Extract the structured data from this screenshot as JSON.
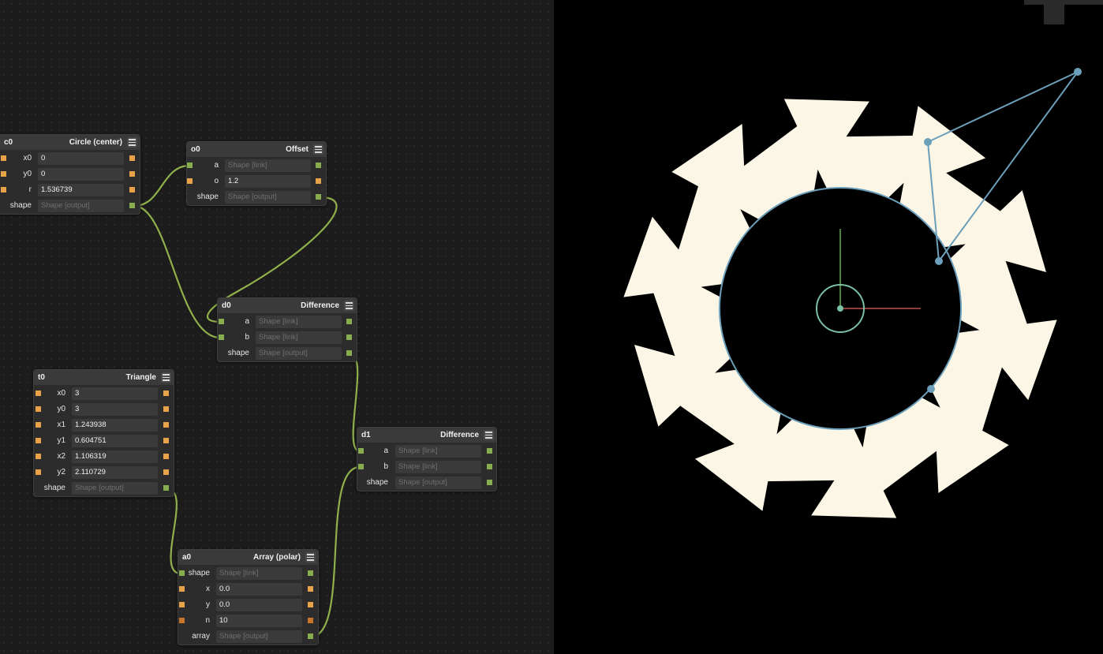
{
  "graph": {
    "nodes": {
      "c0": {
        "name": "c0",
        "type": "Circle (center)",
        "rows": [
          {
            "label": "x0",
            "value": "0",
            "placeholder": false
          },
          {
            "label": "y0",
            "value": "0",
            "placeholder": false
          },
          {
            "label": "r",
            "value": "1.536739",
            "placeholder": false
          },
          {
            "label": "shape",
            "value": "Shape [output]",
            "placeholder": true
          }
        ]
      },
      "o0": {
        "name": "o0",
        "type": "Offset",
        "rows": [
          {
            "label": "a",
            "value": "Shape [link]",
            "placeholder": true
          },
          {
            "label": "o",
            "value": "1.2",
            "placeholder": false
          },
          {
            "label": "shape",
            "value": "Shape [output]",
            "placeholder": true
          }
        ]
      },
      "d0": {
        "name": "d0",
        "type": "Difference",
        "rows": [
          {
            "label": "a",
            "value": "Shape [link]",
            "placeholder": true
          },
          {
            "label": "b",
            "value": "Shape [link]",
            "placeholder": true
          },
          {
            "label": "shape",
            "value": "Shape [output]",
            "placeholder": true
          }
        ]
      },
      "t0": {
        "name": "t0",
        "type": "Triangle",
        "rows": [
          {
            "label": "x0",
            "value": "3",
            "placeholder": false
          },
          {
            "label": "y0",
            "value": "3",
            "placeholder": false
          },
          {
            "label": "x1",
            "value": "1.243938",
            "placeholder": false
          },
          {
            "label": "y1",
            "value": "0.604751",
            "placeholder": false
          },
          {
            "label": "x2",
            "value": "1.106319",
            "placeholder": false
          },
          {
            "label": "y2",
            "value": "2.110729",
            "placeholder": false
          },
          {
            "label": "shape",
            "value": "Shape [output]",
            "placeholder": true
          }
        ]
      },
      "d1": {
        "name": "d1",
        "type": "Difference",
        "rows": [
          {
            "label": "a",
            "value": "Shape [link]",
            "placeholder": true
          },
          {
            "label": "b",
            "value": "Shape [link]",
            "placeholder": true
          },
          {
            "label": "shape",
            "value": "Shape [output]",
            "placeholder": true
          }
        ]
      },
      "a0": {
        "name": "a0",
        "type": "Array (polar)",
        "rows": [
          {
            "label": "shape",
            "value": "Shape [link]",
            "placeholder": true
          },
          {
            "label": "x",
            "value": "0.0",
            "placeholder": false
          },
          {
            "label": "y",
            "value": "0.0",
            "placeholder": false
          },
          {
            "label": "n",
            "value": "10",
            "placeholder": false
          },
          {
            "label": "array",
            "value": "Shape [output]",
            "placeholder": true
          }
        ]
      }
    },
    "menu_icon": "hamburger-icon",
    "colors": {
      "wire": "#8fb04a",
      "number_port": "#e8a24a",
      "shape_port": "#87ad4e",
      "background": "#1c1c1c"
    }
  },
  "viewport": {
    "colors": {
      "shape_fill": "#fcf6e6",
      "background": "#000000",
      "control_handle": "#6c9fba",
      "x_axis": "#c0504d",
      "y_axis": "#6aa85a",
      "origin_ring": "#7cc0a4"
    }
  }
}
